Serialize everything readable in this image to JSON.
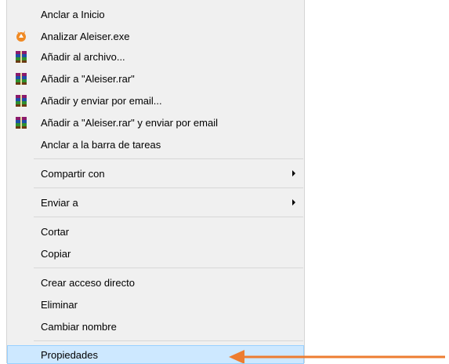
{
  "menu": {
    "items": [
      {
        "label": "Anclar a Inicio",
        "icon": "none"
      },
      {
        "label": "Analizar Aleiser.exe",
        "icon": "avast-icon"
      },
      {
        "label": "Añadir al archivo...",
        "icon": "winrar-icon"
      },
      {
        "label": "Añadir a \"Aleiser.rar\"",
        "icon": "winrar-icon"
      },
      {
        "label": "Añadir y enviar por email...",
        "icon": "winrar-icon"
      },
      {
        "label": "Añadir a \"Aleiser.rar\" y enviar por email",
        "icon": "winrar-icon"
      },
      {
        "label": "Anclar a la barra de tareas",
        "icon": "none"
      },
      {
        "label": "Compartir con",
        "submenu": true
      },
      {
        "label": "Enviar a",
        "submenu": true
      },
      {
        "label": "Cortar"
      },
      {
        "label": "Copiar"
      },
      {
        "label": "Crear acceso directo"
      },
      {
        "label": "Eliminar"
      },
      {
        "label": "Cambiar nombre"
      },
      {
        "label": "Propiedades",
        "highlighted": true
      }
    ]
  },
  "colors": {
    "menu_background": "#f0f0f0",
    "highlight_background": "#cde8ff",
    "highlight_border": "#99d1ff",
    "annotation_arrow": "#ed7d31"
  }
}
